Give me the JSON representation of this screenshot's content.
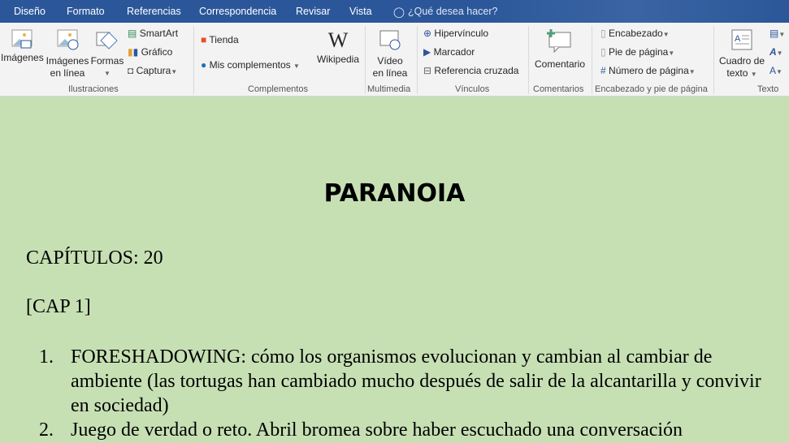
{
  "tabs": [
    "Diseño",
    "Formato",
    "Referencias",
    "Correspondencia",
    "Revisar",
    "Vista"
  ],
  "tell_me": "¿Qué desea hacer?",
  "ribbon": {
    "imagenes": "Imágenes",
    "imagenes_linea_1": "Imágenes",
    "imagenes_linea_2": "en línea",
    "formas": "Formas",
    "smartart": "SmartArt",
    "grafico": "Gráfico",
    "captura": "Captura",
    "ilustraciones": "Ilustraciones",
    "tienda": "Tienda",
    "mis_complementos": "Mis complementos",
    "wikipedia": "Wikipedia",
    "complementos": "Complementos",
    "video_1": "Vídeo",
    "video_2": "en línea",
    "multimedia": "Multimedia",
    "hipervinculo": "Hipervínculo",
    "marcador": "Marcador",
    "referencia": "Referencia cruzada",
    "vinculos": "Vínculos",
    "comentario": "Comentario",
    "comentarios": "Comentarios",
    "encabezado": "Encabezado",
    "pie": "Pie de página",
    "numero": "Número de página",
    "encabezado_group": "Encabezado y pie de página",
    "cuadro_1": "Cuadro de",
    "cuadro_2": "texto",
    "texto": "Texto"
  },
  "document": {
    "title": "PARANOIA",
    "chapters": "CAPÍTULOS: 20",
    "cap": "[CAP 1]",
    "items": [
      {
        "n": "1.",
        "text": "FORESHADOWING: cómo los organismos evolucionan y cambian al cambiar de ambiente (las tortugas han cambiado mucho después de salir de la alcantarilla y convivir en sociedad)"
      },
      {
        "n": "2.",
        "text": "Juego de verdad o reto. Abril bromea sobre haber escuchado una conversación"
      }
    ]
  },
  "colors": {
    "tabbar": "#2b579a",
    "ribbon": "#f3f3f3",
    "page": "#c6e0b4"
  }
}
